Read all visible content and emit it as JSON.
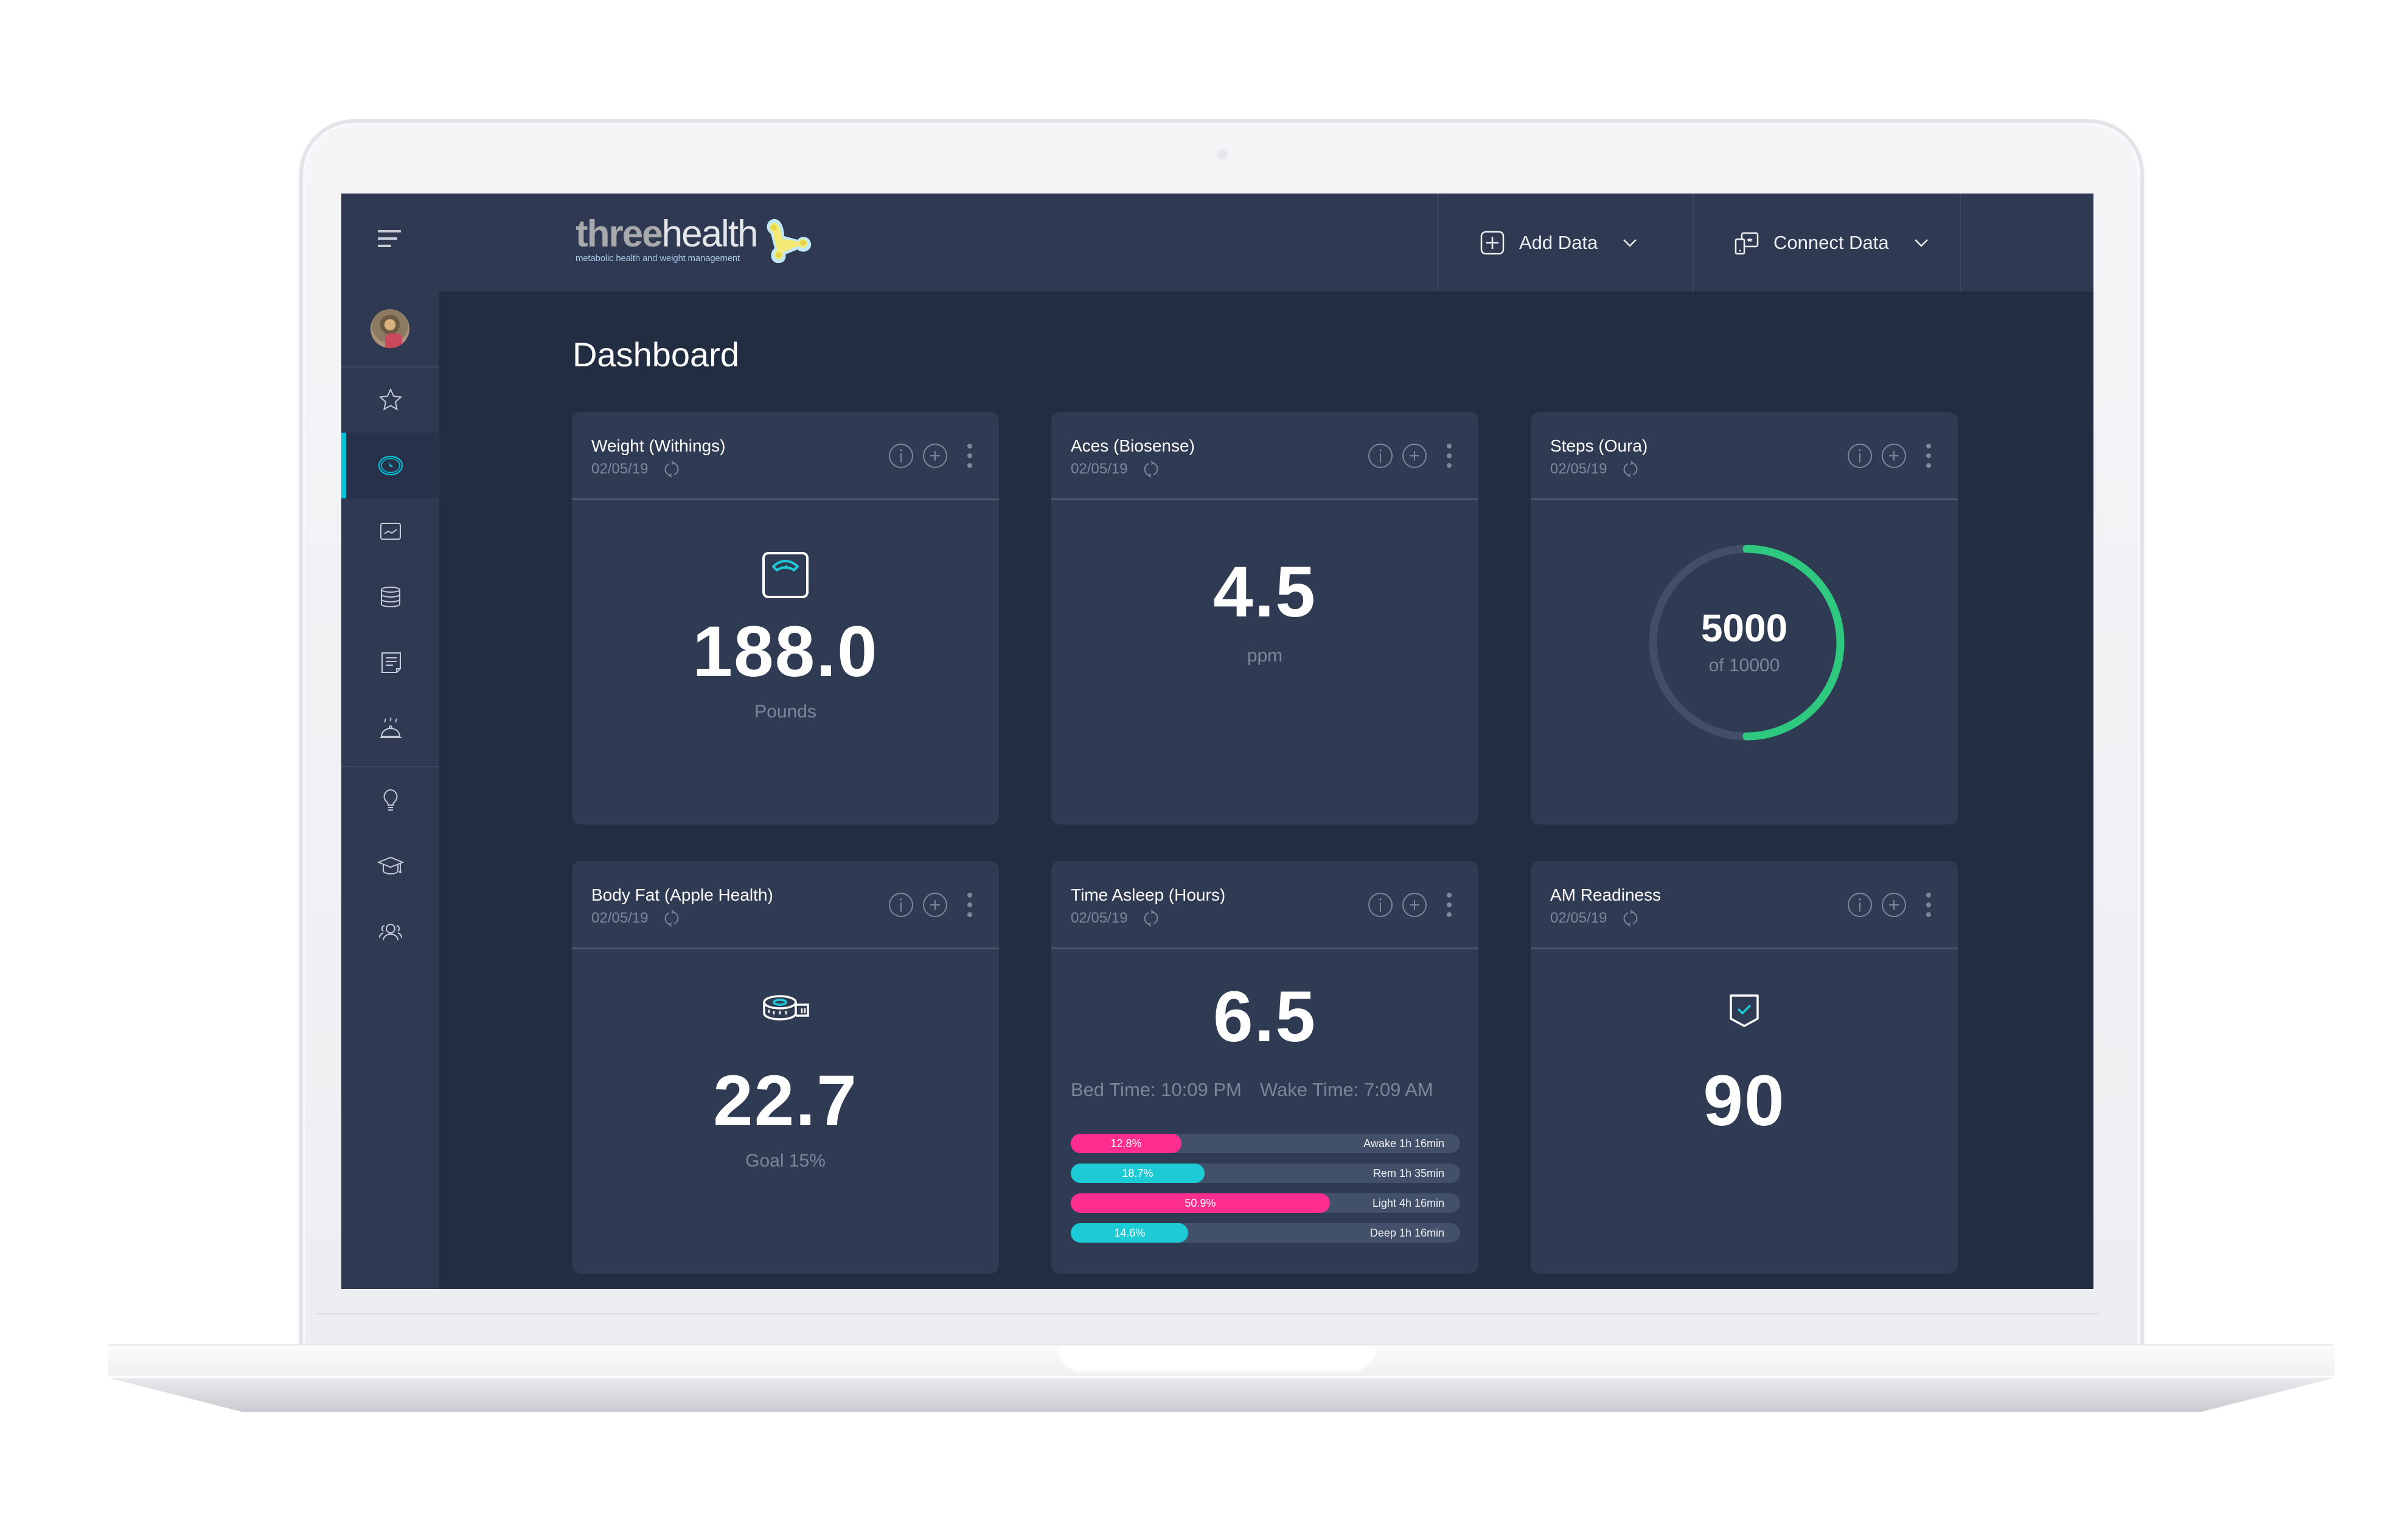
{
  "app": {
    "brand_bold": "three",
    "brand_light": "health",
    "tagline": "metabolic health and weight management"
  },
  "header": {
    "add_data_label": "Add Data",
    "connect_data_label": "Connect Data"
  },
  "sidebar": {
    "items": [
      {
        "name": "favorites",
        "icon": "star-icon",
        "active": false
      },
      {
        "name": "dashboard",
        "icon": "gauge-icon",
        "active": true
      },
      {
        "name": "trends",
        "icon": "chart-line-icon",
        "active": false
      },
      {
        "name": "data",
        "icon": "database-icon",
        "active": false
      },
      {
        "name": "notes",
        "icon": "note-icon",
        "active": false
      },
      {
        "name": "meals",
        "icon": "food-cloche-icon",
        "active": false
      },
      {
        "name": "insights",
        "icon": "lightbulb-icon",
        "active": false
      },
      {
        "name": "learn",
        "icon": "graduation-cap-icon",
        "active": false
      },
      {
        "name": "community",
        "icon": "users-icon",
        "active": false
      }
    ],
    "accent_color": "#00c2d6"
  },
  "page": {
    "title": "Dashboard"
  },
  "cards": [
    {
      "title": "Weight (Withings)",
      "date": "02/05/19",
      "value": "188.0",
      "unit": "Pounds",
      "icon": "scale-icon"
    },
    {
      "title": "Aces (Biosense)",
      "date": "02/05/19",
      "value": "4.5",
      "unit": "ppm"
    },
    {
      "title": "Steps (Oura)",
      "date": "02/05/19",
      "value": "5000",
      "goal_text": "of 10000",
      "progress": 0.5,
      "progress_color": "#2ec87f"
    },
    {
      "title": "Body Fat (Apple Health)",
      "date": "02/05/19",
      "value": "22.7",
      "unit": "Goal 15%",
      "icon": "tape-measure-icon"
    },
    {
      "title": "Time Asleep (Hours)",
      "date": "02/05/19",
      "value": "6.5",
      "bed_time": "Bed Time: 10:09 PM",
      "wake_time": "Wake Time: 7:09 AM",
      "stages": [
        {
          "pct_label": "12.8%",
          "pct": 12.8,
          "label": "Awake 1h 16min",
          "color": "#ff2d8e"
        },
        {
          "pct_label": "18.7%",
          "pct": 18.7,
          "label": "Rem 1h 35min",
          "color": "#1ccbd6"
        },
        {
          "pct_label": "50.9%",
          "pct": 50.9,
          "label": "Light 4h 16min",
          "color": "#ff2d8e"
        },
        {
          "pct_label": "14.6%",
          "pct": 14.6,
          "label": "Deep 1h 16min",
          "color": "#1ccbd6"
        }
      ]
    },
    {
      "title": "AM Readiness",
      "date": "02/05/19",
      "value": "90",
      "icon": "shield-check-icon"
    }
  ]
}
